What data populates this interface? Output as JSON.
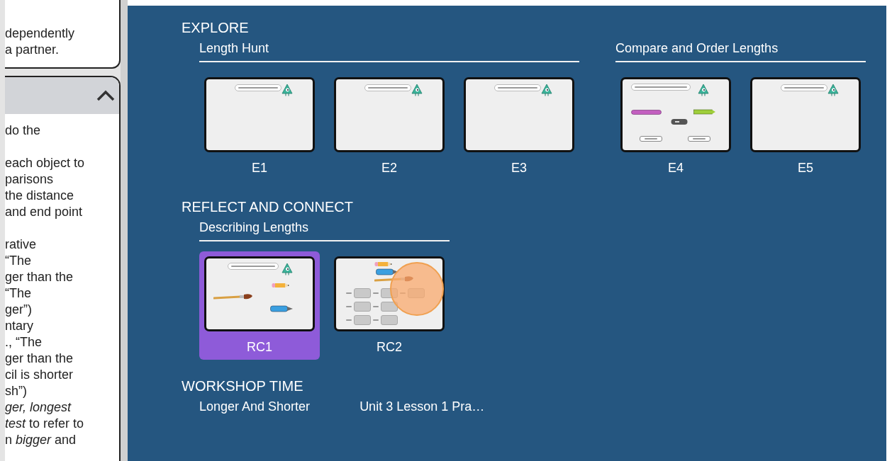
{
  "sidebar": {
    "top_card": {
      "lines": [
        "dependently",
        "a partner."
      ]
    },
    "panel": {
      "expanded": true,
      "paragraphs": [
        [
          "do the"
        ],
        [
          "each object to",
          "parisons",
          "the distance",
          "and end point"
        ],
        [
          "rative",
          "“The",
          "ger than the",
          "“The",
          "ger”)",
          "ntary",
          "., “The",
          "ger than the",
          "cil is shorter",
          "sh”)",
          "*ger, longest*",
          "*test* to refer to",
          "n *bigger* and"
        ]
      ]
    }
  },
  "sections": [
    {
      "title": "EXPLORE",
      "groups": [
        {
          "title": "Length Hunt",
          "items": [
            {
              "label": "E1",
              "selected": false,
              "thumb": {
                "kind": "prompt"
              }
            },
            {
              "label": "E2",
              "selected": false,
              "thumb": {
                "kind": "prompt"
              }
            },
            {
              "label": "E3",
              "selected": false,
              "thumb": {
                "kind": "prompt"
              }
            }
          ]
        },
        {
          "title": "Compare and Order Lengths",
          "items": [
            {
              "label": "E4",
              "selected": false,
              "thumb": {
                "kind": "compare"
              }
            },
            {
              "label": "E5",
              "selected": false,
              "thumb": {
                "kind": "prompt"
              }
            }
          ]
        }
      ]
    },
    {
      "title": "REFLECT AND CONNECT",
      "groups": [
        {
          "title": "Describing Lengths",
          "items": [
            {
              "label": "RC1",
              "selected": true,
              "thumb": {
                "kind": "describe"
              }
            },
            {
              "label": "RC2",
              "selected": false,
              "thumb": {
                "kind": "sentences"
              }
            }
          ]
        }
      ]
    },
    {
      "title": "WORKSHOP TIME",
      "groups": [
        {
          "title": "Longer And Shorter"
        },
        {
          "title": "Unit 3 Lesson 1 Pra…"
        }
      ]
    }
  ]
}
